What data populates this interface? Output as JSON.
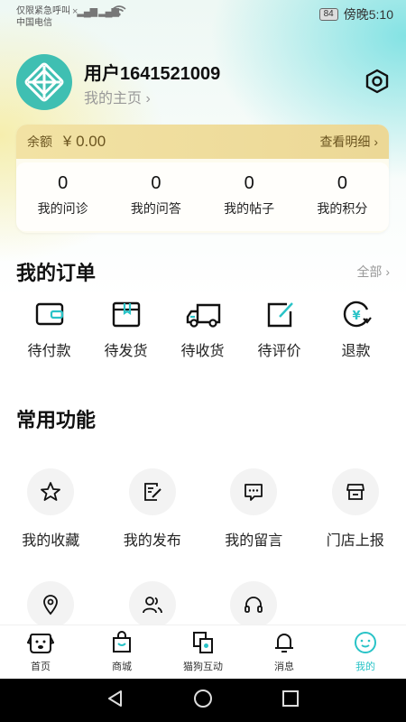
{
  "status_bar": {
    "carrier_line1": "仅限紧急呼叫",
    "carrier_line2": "中国电信",
    "battery": "84",
    "time": "傍晚5:10"
  },
  "profile": {
    "username": "用户1641521009",
    "homepage_link": "我的主页 ›"
  },
  "wallet": {
    "balance_label": "余额",
    "balance_value": "¥ 0.00",
    "details_link": "查看明细 ›",
    "stats": [
      {
        "value": "0",
        "label": "我的问诊"
      },
      {
        "value": "0",
        "label": "我的问答"
      },
      {
        "value": "0",
        "label": "我的帖子"
      },
      {
        "value": "0",
        "label": "我的积分"
      }
    ]
  },
  "orders": {
    "title": "我的订单",
    "all_link": "全部 ›",
    "items": [
      {
        "label": "待付款",
        "icon": "wallet-icon"
      },
      {
        "label": "待发货",
        "icon": "package-icon"
      },
      {
        "label": "待收货",
        "icon": "truck-icon"
      },
      {
        "label": "待评价",
        "icon": "edit-icon"
      },
      {
        "label": "退款",
        "icon": "refund-icon"
      }
    ]
  },
  "features": {
    "title": "常用功能",
    "items": [
      {
        "label": "我的收藏",
        "icon": "star-icon"
      },
      {
        "label": "我的发布",
        "icon": "note-edit-icon"
      },
      {
        "label": "我的留言",
        "icon": "message-icon"
      },
      {
        "label": "门店上报",
        "icon": "store-icon"
      },
      {
        "label": "",
        "icon": "location-icon"
      },
      {
        "label": "",
        "icon": "users-icon"
      },
      {
        "label": "",
        "icon": "headset-icon"
      }
    ]
  },
  "tabbar": {
    "active_color": "#29c3c7",
    "items": [
      {
        "label": "首页",
        "icon": "dog-face-icon"
      },
      {
        "label": "商城",
        "icon": "shopping-bag-icon"
      },
      {
        "label": "猫狗互动",
        "icon": "interaction-icon"
      },
      {
        "label": "消息",
        "icon": "bell-icon"
      },
      {
        "label": "我的",
        "icon": "profile-face-icon"
      }
    ]
  }
}
